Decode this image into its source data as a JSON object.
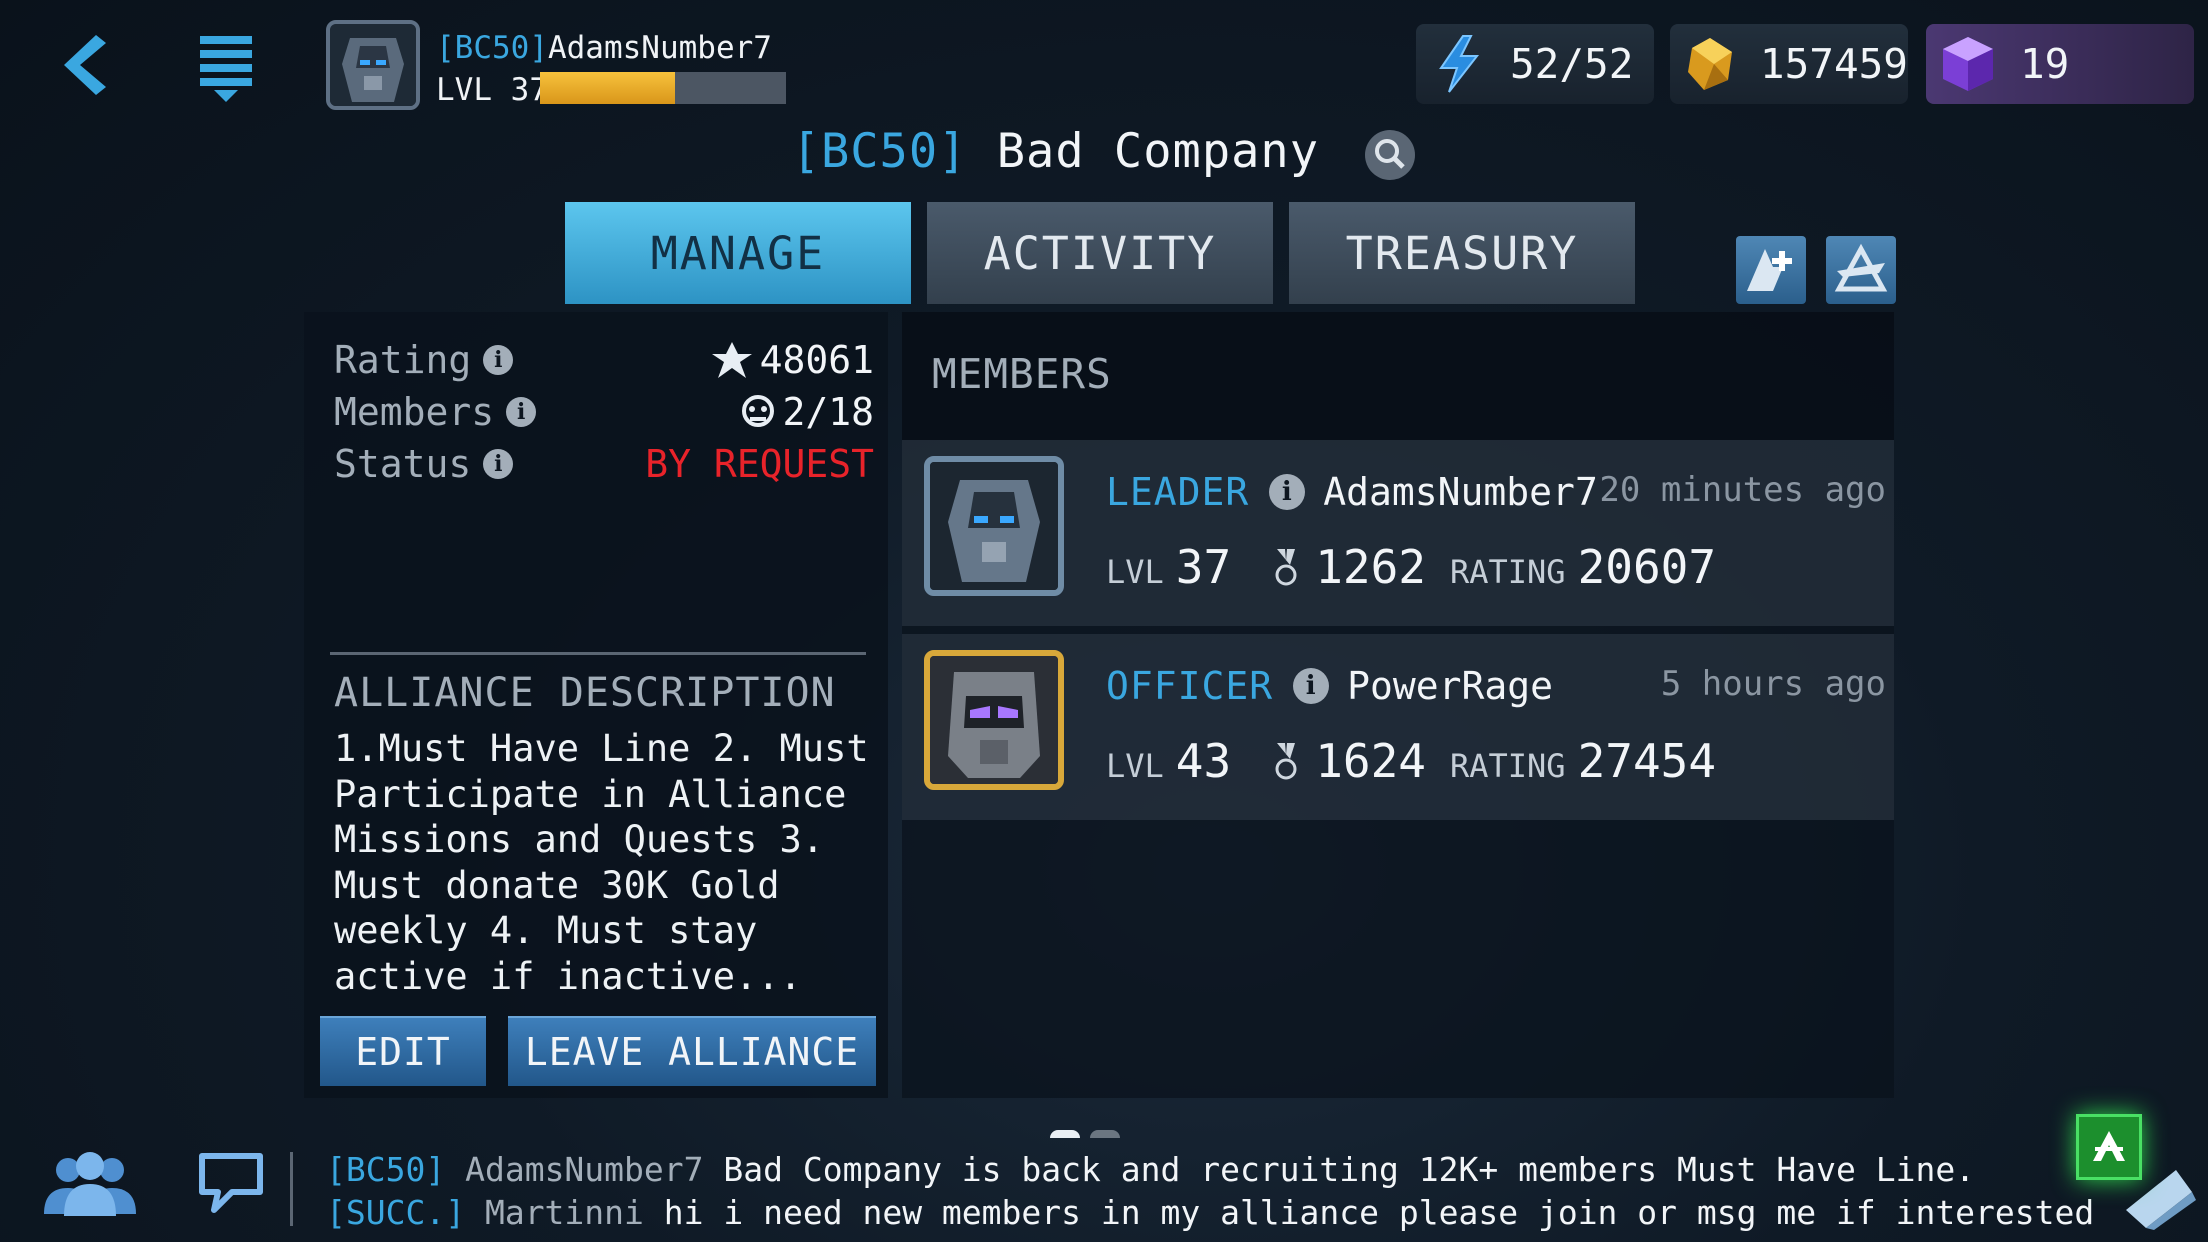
{
  "player": {
    "tag": "[BC50]",
    "name": "AdamsNumber7",
    "level": "LVL 37",
    "xp_progress": 0.55
  },
  "resources": {
    "energy": "52/52",
    "gold": "157459",
    "gems": "19"
  },
  "alliance": {
    "tag": "[BC50]",
    "name": "Bad Company"
  },
  "tabs": {
    "manage": "MANAGE",
    "activity": "ACTIVITY",
    "treasury": "TREASURY",
    "active": "manage"
  },
  "stats": {
    "rating_label": "Rating",
    "rating_value": "48061",
    "members_label": "Members",
    "members_value": "2/18",
    "status_label": "Status",
    "status_value": "BY REQUEST"
  },
  "description": {
    "heading": "ALLIANCE DESCRIPTION",
    "text": "1.Must Have Line 2. Must Participate in Alliance Missions and Quests 3. Must donate 30K Gold weekly 4. Must stay active if inactive..."
  },
  "buttons": {
    "edit": "EDIT",
    "leave": "LEAVE ALLIANCE"
  },
  "members": {
    "title": "MEMBERS",
    "rows": [
      {
        "role": "LEADER",
        "name": "AdamsNumber7",
        "time": "20 minutes ago",
        "lvl_label": "LVL",
        "lvl": "37",
        "medals": "1262",
        "rating_label": "RATING",
        "rating": "20607",
        "frame_color": "#6f8ca6"
      },
      {
        "role": "OFFICER",
        "name": "PowerRage",
        "time": "5 hours ago",
        "lvl_label": "LVL",
        "lvl": "43",
        "medals": "1624",
        "rating_label": "RATING",
        "rating": "27454",
        "frame_color": "#d8a83a"
      }
    ]
  },
  "chat": [
    {
      "tag": "[BC50]",
      "who": "AdamsNumber7",
      "text": "Bad Company is back and recruiting 12K+ members Must Have Line."
    },
    {
      "tag": "[SUCC.]",
      "who": "Martinni",
      "text": "hi i need new members in my alliance please join or msg me if interested"
    }
  ],
  "colors": {
    "accent": "#3aa7e0",
    "status": "#e8232a",
    "tab_active": "#5cc6ee",
    "gold_bar": "#f7c23c"
  },
  "icons": {
    "back": "chevron-left-icon",
    "menu": "menu-icon",
    "energy": "lightning-icon",
    "gold": "gold-icon",
    "gems": "gem-icon",
    "search": "search-icon",
    "alliance_add": "alliance-add-icon",
    "alliance_emblem": "alliance-emblem-icon"
  }
}
